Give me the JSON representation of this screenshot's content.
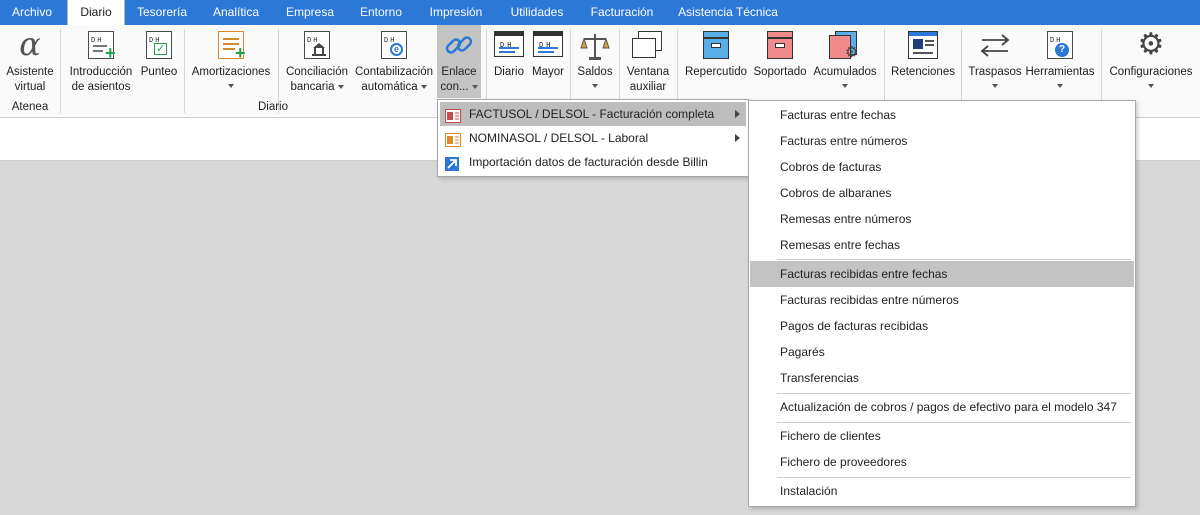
{
  "menubar": {
    "tabs": [
      {
        "label": "Archivo",
        "active": false
      },
      {
        "label": "Diario",
        "active": true
      },
      {
        "label": "Tesorería",
        "active": false
      },
      {
        "label": "Analítica",
        "active": false
      },
      {
        "label": "Empresa",
        "active": false
      },
      {
        "label": "Entorno",
        "active": false
      },
      {
        "label": "Impresión",
        "active": false
      },
      {
        "label": "Utilidades",
        "active": false
      },
      {
        "label": "Facturación",
        "active": false
      },
      {
        "label": "Asistencia Técnica",
        "active": false
      }
    ]
  },
  "ribbon": {
    "asistente": {
      "line1": "Asistente",
      "line2": "virtual"
    },
    "introduccion": {
      "line1": "Introducción",
      "line2": "de asientos"
    },
    "punteo": {
      "line1": "Punteo"
    },
    "amortizaciones": {
      "line1": "Amortizaciones"
    },
    "conciliacion": {
      "line1": "Conciliación",
      "line2": "bancaria"
    },
    "contabilizacion": {
      "line1": "Contabilización",
      "line2": "automática"
    },
    "enlace": {
      "line1": "Enlace",
      "line2": "con..."
    },
    "diario": {
      "line1": "Diario"
    },
    "mayor": {
      "line1": "Mayor"
    },
    "saldos": {
      "line1": "Saldos"
    },
    "ventana": {
      "line1": "Ventana",
      "line2": "auxiliar"
    },
    "repercutido": {
      "line1": "Repercutido"
    },
    "soportado": {
      "line1": "Soportado"
    },
    "acumulados": {
      "line1": "Acumulados"
    },
    "retenciones": {
      "line1": "Retenciones"
    },
    "traspasos": {
      "line1": "Traspasos"
    },
    "herramientas": {
      "line1": "Herramientas"
    },
    "configuraciones": {
      "line1": "Configuraciones"
    },
    "groups": {
      "atenea": "Atenea",
      "diario": "Diario"
    }
  },
  "enlace_menu": {
    "items": [
      {
        "label": "FACTUSOL / DELSOL - Facturación completa",
        "icon": "factusol-icon"
      },
      {
        "label": "NOMINASOL / DELSOL - Laboral",
        "icon": "nominasol-icon"
      },
      {
        "label": "Importación datos de facturación desde Billin",
        "icon": "import-arrow-icon"
      }
    ]
  },
  "factusol_submenu": {
    "items": [
      "Facturas entre fechas",
      "Facturas entre números",
      "Cobros de facturas",
      "Cobros de albaranes",
      "Remesas entre números",
      "Remesas entre fechas",
      "Facturas recibidas entre fechas",
      "Facturas recibidas entre números",
      "Pagos de facturas recibidas",
      "Pagarés",
      "Transferencias",
      "Actualización de cobros / pagos de efectivo para el modelo 347",
      "Fichero de clientes",
      "Fichero de proveedores",
      "Instalación"
    ]
  },
  "colors": {
    "menubar": "#2b78d6",
    "highlight": "#bdbdbd",
    "pressed": "#c4c4c4",
    "workarea": "#d8d8d8"
  }
}
